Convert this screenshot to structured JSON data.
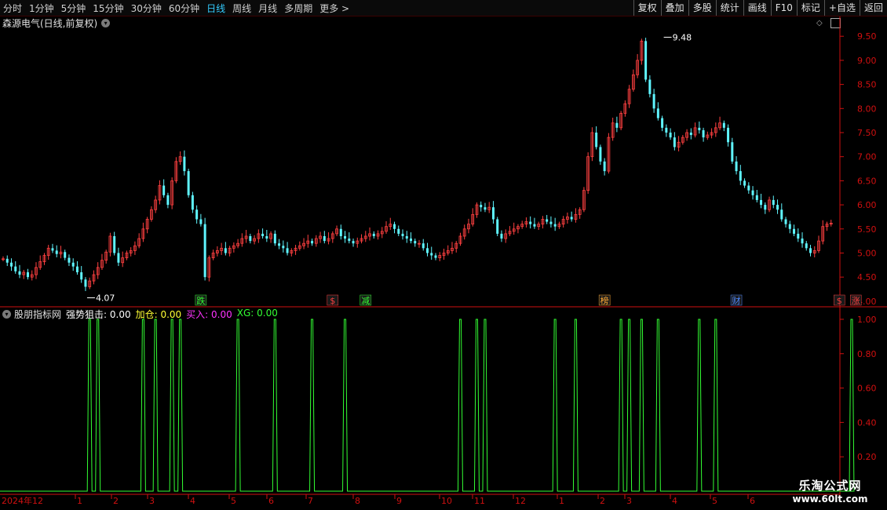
{
  "toolbar": {
    "periods": [
      "分时",
      "1分钟",
      "5分钟",
      "15分钟",
      "30分钟",
      "60分钟",
      "日线",
      "周线",
      "月线",
      "多周期",
      "更多 >"
    ],
    "active_period": "日线",
    "tools": [
      "复权",
      "叠加",
      "多股",
      "统计",
      "画线",
      "F10",
      "标记",
      "+自选",
      "返回"
    ]
  },
  "header": {
    "title": "森源电气(日线,前复权)"
  },
  "indicator": {
    "name": "股朋指标网",
    "items": [
      {
        "label": "强势狙击: 0.00",
        "color": "#ffffff"
      },
      {
        "label": "加仓: 0.00",
        "color": "#ffff33"
      },
      {
        "label": "买入: 0.00",
        "color": "#ff33ff"
      },
      {
        "label": "XG: 0.00",
        "color": "#33ff33"
      }
    ]
  },
  "watermark": {
    "line1": "乐淘公式网",
    "line2": "www.60lt.com"
  },
  "colors": {
    "up": "#ff4040",
    "down": "#5ff5ff",
    "signal": "#33ff33",
    "axis": "#d01010"
  },
  "chart_data": [
    {
      "type": "candlestick",
      "title": "森源电气(日线,前复权)",
      "ylim": [
        3.9,
        9.65
      ],
      "y_ticks": [
        4.0,
        4.5,
        5.0,
        5.5,
        6.0,
        6.5,
        7.0,
        7.5,
        8.0,
        8.5,
        9.0,
        9.5
      ],
      "annotations": [
        {
          "text": "4.07",
          "x_index": 20,
          "value": 4.07
        },
        {
          "text": "9.48",
          "x_index": 160,
          "value": 9.48
        }
      ],
      "markers": [
        {
          "text": "跌",
          "x_index": 48,
          "color": "#33ff33"
        },
        {
          "text": "$",
          "x_index": 80,
          "color": "#ff4040"
        },
        {
          "text": "减",
          "x_index": 88,
          "color": "#33ff33"
        },
        {
          "text": "榜",
          "x_index": 146,
          "color": "#ffaa33"
        },
        {
          "text": "财",
          "x_index": 178,
          "color": "#4d88ff"
        },
        {
          "text": "$",
          "x_index": 203,
          "color": "#ff4040"
        },
        {
          "text": "涨",
          "x_index": 207,
          "color": "#ff4040"
        }
      ],
      "closes": [
        4.88,
        4.8,
        4.72,
        4.62,
        4.55,
        4.6,
        4.5,
        4.55,
        4.7,
        4.82,
        4.95,
        5.1,
        5.05,
        4.98,
        5.02,
        4.9,
        4.8,
        4.72,
        4.6,
        4.45,
        4.3,
        4.42,
        4.55,
        4.7,
        4.85,
        5.02,
        5.35,
        5.0,
        4.8,
        4.9,
        5.0,
        5.05,
        5.15,
        5.3,
        5.5,
        5.7,
        5.9,
        6.1,
        6.4,
        6.2,
        6.0,
        6.5,
        6.9,
        7.0,
        6.7,
        6.2,
        5.9,
        5.7,
        5.6,
        4.5,
        4.9,
        5.0,
        5.05,
        5.1,
        5.0,
        5.1,
        5.15,
        5.2,
        5.3,
        5.35,
        5.25,
        5.3,
        5.4,
        5.35,
        5.3,
        5.4,
        5.2,
        5.15,
        5.1,
        5.0,
        5.05,
        5.1,
        5.15,
        5.2,
        5.25,
        5.2,
        5.3,
        5.35,
        5.25,
        5.3,
        5.4,
        5.5,
        5.35,
        5.3,
        5.25,
        5.2,
        5.25,
        5.3,
        5.35,
        5.4,
        5.35,
        5.4,
        5.45,
        5.55,
        5.6,
        5.5,
        5.4,
        5.35,
        5.3,
        5.25,
        5.2,
        5.2,
        5.1,
        5.0,
        4.95,
        4.9,
        4.95,
        5.0,
        5.05,
        5.1,
        5.2,
        5.35,
        5.5,
        5.6,
        5.8,
        6.0,
        5.95,
        5.9,
        5.95,
        5.7,
        5.4,
        5.3,
        5.4,
        5.45,
        5.5,
        5.55,
        5.6,
        5.65,
        5.6,
        5.55,
        5.6,
        5.7,
        5.65,
        5.6,
        5.55,
        5.6,
        5.7,
        5.75,
        5.7,
        5.8,
        5.9,
        6.3,
        7.0,
        7.5,
        7.2,
        6.9,
        6.7,
        7.4,
        7.7,
        7.6,
        7.9,
        8.1,
        8.4,
        8.7,
        9.0,
        9.4,
        8.6,
        8.3,
        8.0,
        7.8,
        7.6,
        7.5,
        7.4,
        7.2,
        7.3,
        7.4,
        7.5,
        7.45,
        7.6,
        7.55,
        7.4,
        7.45,
        7.5,
        7.6,
        7.7,
        7.6,
        7.3,
        6.9,
        6.7,
        6.5,
        6.4,
        6.3,
        6.2,
        6.1,
        6.0,
        5.9,
        6.1,
        6.0,
        5.9,
        5.7,
        5.6,
        5.5,
        5.4,
        5.3,
        5.2,
        5.1,
        5.0,
        5.05,
        5.25,
        5.55,
        5.6,
        5.62
      ]
    },
    {
      "type": "line",
      "name": "股朋指标网",
      "ylim": [
        0,
        1.05
      ],
      "y_ticks": [
        0.2,
        0.4,
        0.6,
        0.8,
        1.0
      ],
      "x_labels": [
        "2024年12",
        "1",
        "2",
        "3",
        "4",
        "5",
        "6",
        "7",
        "8",
        "9",
        "10",
        "11",
        "12",
        "1",
        "2",
        "3",
        "4",
        "5",
        "6"
      ],
      "spikes_at": [
        21,
        23,
        34,
        37,
        41,
        43,
        57,
        66,
        75,
        83,
        111,
        115,
        117,
        134,
        139,
        150,
        152,
        155,
        159,
        169,
        173,
        206
      ],
      "values": []
    }
  ]
}
